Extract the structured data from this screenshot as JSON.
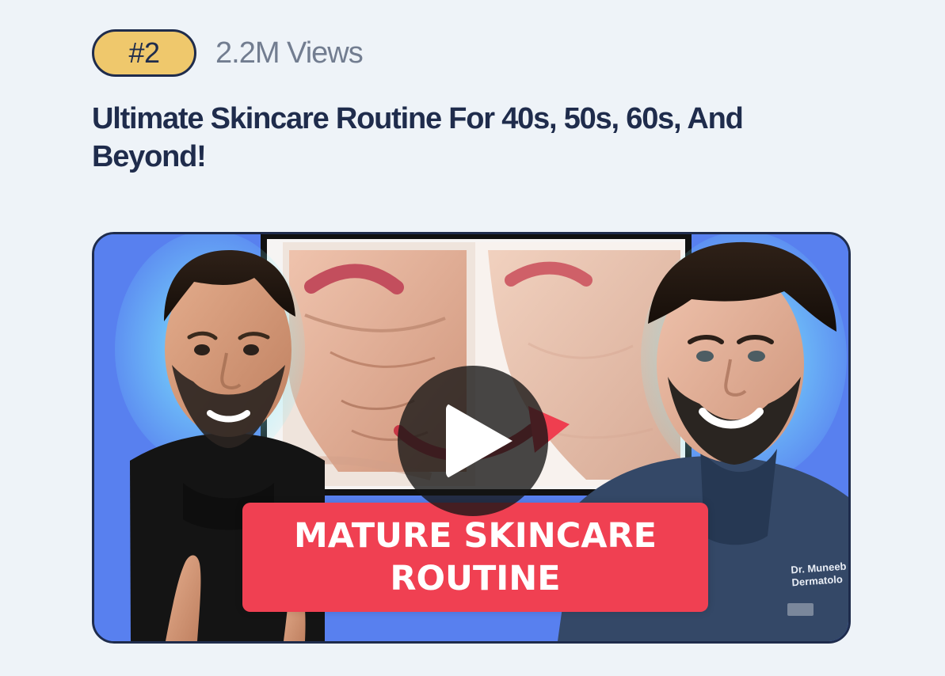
{
  "card": {
    "rank_label": "#2",
    "views_label": "2.2M Views",
    "title": "Ultimate Skincare Routine For 40s, 50s, 60s, And Beyond!"
  },
  "thumbnail": {
    "banner_line_1": "MATURE SKINCARE",
    "banner_line_2": "ROUTINE",
    "scrub_name_line_1": "Dr. Muneeb",
    "scrub_name_line_2": "Dermatolo"
  },
  "colors": {
    "badge_background": "#efc86c",
    "heading_text": "#1f2c4c",
    "views_text": "#727d90",
    "page_background": "#eef3f8",
    "banner_red": "#f04052",
    "thumbnail_blue": "#5d8af2"
  },
  "icons": {
    "play": "play-icon"
  }
}
